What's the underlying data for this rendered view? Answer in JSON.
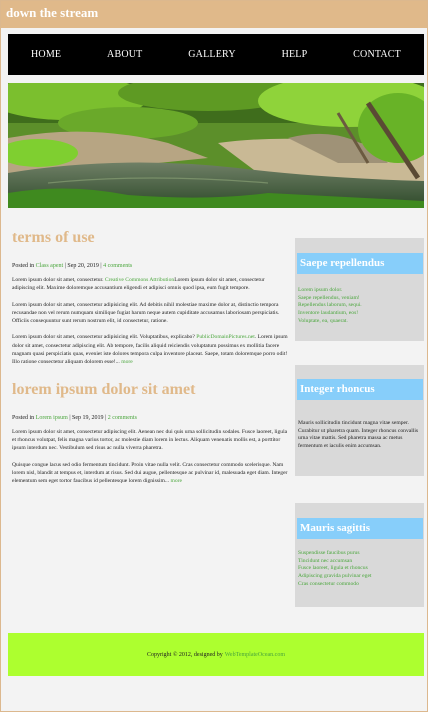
{
  "site": {
    "title": "down the stream"
  },
  "nav": {
    "items": [
      {
        "label": "HOME"
      },
      {
        "label": "ABOUT"
      },
      {
        "label": "GALLERY"
      },
      {
        "label": "HELP"
      },
      {
        "label": "CONTACT"
      }
    ]
  },
  "posts": [
    {
      "title": "terms of use",
      "meta_prefix": "Posted in",
      "category": "Class apent",
      "date": "| Sep 20, 2019 |",
      "comments": "4 comments",
      "p1_a": "Lorem ipsum dolor sit amet, consectetur.",
      "p1_link": "Creative Commons Attribution",
      "p1_b": "Lorem ipsum dolor sit amet, consectetur adipiscing elit. Maxime doloremque accusantium eligendi et adipisci omnis quod ipsa, eum fugit tempore.",
      "p2": "Lorem ipsum dolor sit amet, consectetur adipisicing elit. Ad debitis nihil molestiae maxime dolor at, distinctio tempora recusandae non vel rerum numquam similique fugiat harum neque autem cupiditate accusamus laboriosam perspiciatis. Officiis consequuntur sunt rerum nostrum elit, id consectetur, ratione.",
      "p3_a": "Lorem ipsum dolor sit amet, consectetur adipisicing elit. Voluptatibus, explicabo?",
      "p3_link": "PublicDomainPictures.net",
      "p3_b": ". Lorem ipsum dolor sit amet, consectetur adipiscing elit. Ab tempore, facilis aliquid reiciendis voluptatum possimus ex mollitia facere magnam quasi perspiciatis quas, eveniet iste dolores tempora culpa inventore placeat. Saepe, totam doloremque porro odit! Illo ratione consectetur aliquam dolorem esse!...",
      "more": "more"
    },
    {
      "title": "lorem ipsum dolor sit amet",
      "meta_prefix": "Posted in",
      "category": "Lorem ipsum",
      "date": "| Sep 19, 2019 |",
      "comments": "2 comments",
      "p1": "Lorem ipsum dolor sit amet, consectetur adipiscing elit. Aenean nec dui quis urna sollicitudin sodales. Fusce laoreet, ligula et rhoncus volutpat, felis magna varius tortor, ac molestie diam lorem in lectus. Aliquam venenatis mollis est, a porttitor ipsum interdum nec. Vestibulum sed risus ac nulla viverra pharetra.",
      "p2": "Quisque congue lacus sed odio fermentum tincidunt. Proin vitae nulla velit. Cras consectetur commodo scelerisque. Nam lorem nisl, blandit at tempus et, interdum at risus. Sed dui augue, pellentesque ac pulvinar id, malesuada eget diam. Integer elementum sem eget tortor faucibus id pellentesque lorem dignissim...",
      "more": "more"
    }
  ],
  "sidebar": {
    "w1": {
      "title": "Saepe repellendus",
      "items": [
        "Lorem ipsum dolor.",
        "Saepe repellendus, veniam!",
        "Repellendus laborum, sequi.",
        "Inventore laudantium, eos!",
        "Voluptate, ea, quaerat."
      ]
    },
    "w2": {
      "title": "Integer rhoncus",
      "text": "Mauris sollicitudin tincidunt magna vitae semper. Curabitur ut pharetra quam. Integer rhoncus convallis urna vitae mattis. Sed pharetra massa ac metus fermentum et iaculis enim accumsan."
    },
    "w3": {
      "title": "Mauris sagittis",
      "items": [
        "Suspendisse faucibus purus",
        "Tincidunt nec accumsan",
        "Fusce laoreet, ligula et rhoncus",
        "Adipiscing gravida pulvinar eget",
        "Cras consectetur commodo"
      ]
    }
  },
  "footer": {
    "text": "Copyright © 2012, designed by",
    "link": "WebTemplateOcean.com"
  },
  "colors": {
    "accent": "#e0b98a",
    "nav": "#000000",
    "widget_title": "#87cefa",
    "link": "#4aa63c",
    "footer": "#adff2f"
  }
}
